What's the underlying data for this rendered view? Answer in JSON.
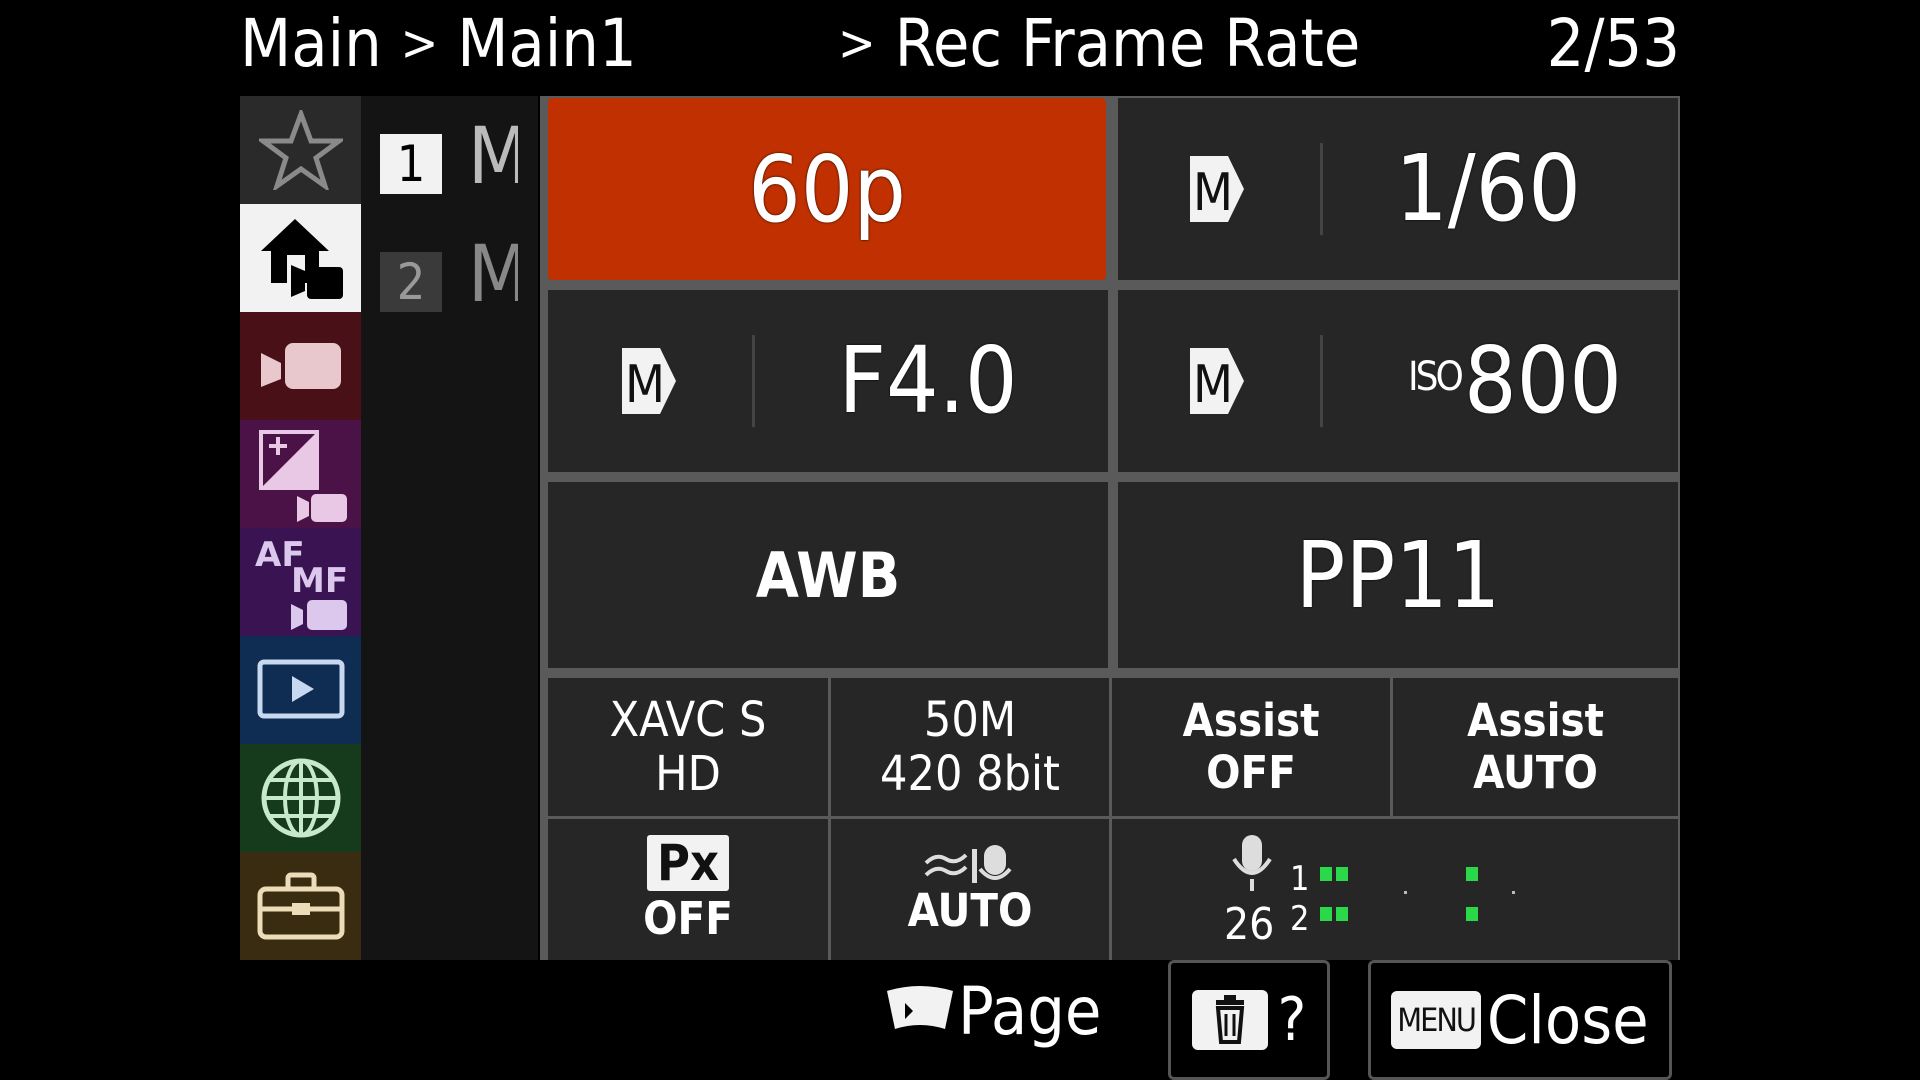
{
  "header": {
    "breadcrumb_root": "Main",
    "breadcrumb_sep": ">",
    "breadcrumb_page": "Main1",
    "item_sep": ">",
    "item_title": "Rec Frame Rate",
    "page_counter": "2/53"
  },
  "sidebar": {
    "categories": [
      {
        "name": "my-menu",
        "icon": "star-icon",
        "color": "#2a2a2a",
        "selected": false
      },
      {
        "name": "main",
        "icon": "home-movie-icon",
        "color": "#f2f2f2",
        "selected": true
      },
      {
        "name": "shooting",
        "icon": "movie-camera-icon",
        "color": "#4a1018"
      },
      {
        "name": "exposure-color",
        "icon": "exposure-icon",
        "color": "#4a1246"
      },
      {
        "name": "focus",
        "icon": "af-mf-icon",
        "color": "#3a1452"
      },
      {
        "name": "playback",
        "icon": "playback-icon",
        "color": "#0f2c52"
      },
      {
        "name": "network",
        "icon": "globe-icon",
        "color": "#153a1c"
      },
      {
        "name": "setup",
        "icon": "toolbox-icon",
        "color": "#3a2c10"
      }
    ],
    "sub_items": [
      {
        "number": "1",
        "label": "M"
      },
      {
        "number": "2",
        "label": "M"
      }
    ]
  },
  "tiles": {
    "frame_rate": "60p",
    "shutter_mode": "M",
    "shutter_speed": "1/60",
    "aperture_mode": "M",
    "aperture": "F4.0",
    "iso_mode": "M",
    "iso_label": "ISO",
    "iso_value": "800",
    "white_balance": "AWB",
    "picture_profile": "PP11",
    "format_line1": "XAVC S",
    "format_line2": "HD",
    "bitrate_line1": "50M",
    "bitrate_line2": "420 8bit",
    "assist1_line1": "Assist",
    "assist1_line2": "OFF",
    "assist2_line1": "Assist",
    "assist2_line2": "AUTO",
    "px_label": "Px",
    "px_value": "OFF",
    "audio_mode": "AUTO",
    "audio_level": "26",
    "audio_ch1": "1",
    "audio_ch2": "2"
  },
  "footer": {
    "page_label": "Page",
    "help_label": "?",
    "menu_badge": "MENU",
    "close_label": "Close"
  },
  "colors": {
    "accent_selected": "#c03000",
    "tile_bg": "#262626",
    "meter_green": "#2bd84a"
  }
}
